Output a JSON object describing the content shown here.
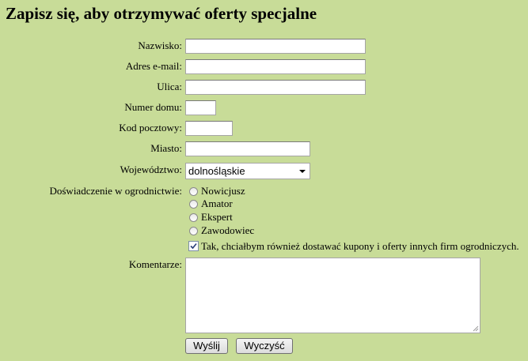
{
  "page": {
    "title": "Zapisz się, aby otrzymywać oferty specjalne"
  },
  "form": {
    "fields": [
      {
        "label": "Nazwisko:",
        "value": ""
      },
      {
        "label": "Adres e-mail:",
        "value": ""
      },
      {
        "label": "Ulica:",
        "value": ""
      },
      {
        "label": "Numer domu:",
        "value": ""
      },
      {
        "label": "Kod pocztowy:",
        "value": ""
      },
      {
        "label": "Miasto:",
        "value": ""
      }
    ],
    "province": {
      "label": "Województwo:",
      "selected": "dolnośląskie"
    },
    "experience": {
      "label": "Doświadczenie w ogrodnictwie:",
      "options": [
        "Nowicjusz",
        "Amator",
        "Ekspert",
        "Zawodowiec"
      ]
    },
    "coupons": {
      "label": "Tak, chciałbym również dostawać kupony i oferty innych firm ogrodniczych.",
      "checked": true
    },
    "comments": {
      "label": "Komentarze:",
      "value": ""
    },
    "buttons": {
      "submit": "Wyślij",
      "reset": "Wyczyść"
    }
  }
}
